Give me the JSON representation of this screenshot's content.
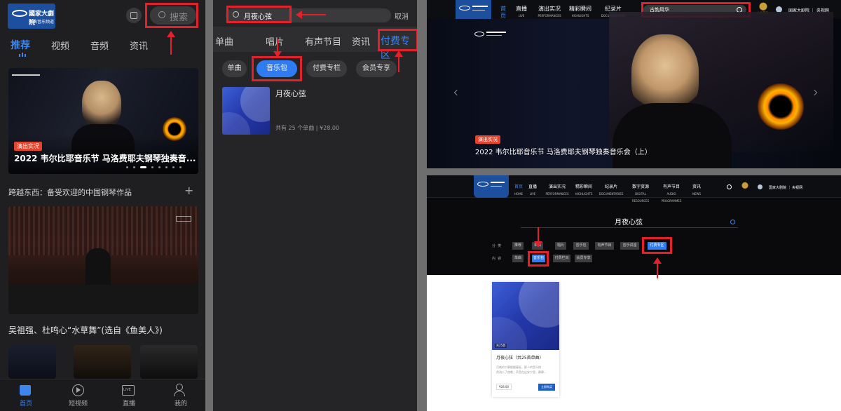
{
  "panel1": {
    "search_placeholder": "搜索",
    "tabs": [
      "推荐",
      "视频",
      "音频",
      "资讯"
    ],
    "logo_title": "國家大劇院",
    "logo_sub": "古典音乐频道",
    "hero": {
      "badge": "演出实况",
      "title": "2022 韦尔比耶音乐节 马洛费耶夫钢琴独奏音..."
    },
    "section_title": "跨越东西：备受欢迎的中国钢琴作品",
    "section_plus": "+",
    "card2_caption": "吴祖强、杜鸣心“水草舞”(选自《鱼美人》)",
    "bottom_nav": [
      "首页",
      "短视频",
      "直播",
      "我的"
    ],
    "live_label": "LIVE"
  },
  "panel2": {
    "search_value": "月夜心弦",
    "cancel": "取消",
    "tabs": [
      "单曲",
      "唱片",
      "有声节目",
      "资讯",
      "付费专区"
    ],
    "chips": [
      "单曲",
      "音乐包",
      "付费专栏",
      "会员专享"
    ],
    "result": {
      "title": "月夜心弦",
      "meta": "共有 25 个单曲 | ¥28.00"
    }
  },
  "panel3": {
    "nav": [
      {
        "cn": "首页",
        "en": "HOME"
      },
      {
        "cn": "直播",
        "en": "LIVE"
      },
      {
        "cn": "演出实况",
        "en": "PERFORMANCES"
      },
      {
        "cn": "精彩瞬间",
        "en": "HIGHLIGHTS"
      },
      {
        "cn": "纪录片",
        "en": "DOCUMENTARIES"
      }
    ],
    "search_value": "古韵风华",
    "right_text": "国家大剧院 ｜ 央视网",
    "hero": {
      "badge": "演出实况",
      "title": "2022 韦尔比耶音乐节 马洛费耶夫钢琴独奏音乐会（上）"
    },
    "brand_mark": "古典音乐"
  },
  "panel4": {
    "nav": [
      {
        "cn": "首页",
        "en": "HOME"
      },
      {
        "cn": "直播",
        "en": "LIVE"
      },
      {
        "cn": "演出实况",
        "en": "PERFORMANCES"
      },
      {
        "cn": "精彩瞬间",
        "en": "HIGHLIGHTS"
      },
      {
        "cn": "纪录片",
        "en": "DOCUMENTARIES"
      },
      {
        "cn": "数字资源",
        "en": "DIGITAL RESOURCES"
      },
      {
        "cn": "有声节目",
        "en": "AUDIO PROGRAMMES"
      },
      {
        "cn": "资讯",
        "en": "NEWS"
      }
    ],
    "right_text": "国家大剧院 ｜ 央视网",
    "search_value": "月夜心弦",
    "filter_row1_label": "分  类",
    "filter_row1": [
      "推荐",
      "单曲",
      "唱片",
      "音乐包",
      "有声节目",
      "音乐讲座",
      "付费专区"
    ],
    "filter_row2_label": "内  容",
    "filter_row2": [
      "单曲",
      "音乐包",
      "付费栏目",
      "会员专享"
    ],
    "card": {
      "count_badge": "共25首",
      "title": "月夜心弦（共25首单曲）",
      "desc_line1": "月夜的宁静缓缓蔓延，醉人的音乐悄",
      "desc_line2": "然流入了夜晚，声音在这安宁里，静静...",
      "price": "¥28.00",
      "buy": "立即购买"
    }
  },
  "colors": {
    "accent_blue": "#2f7bf2",
    "annotation_red": "#e3212b",
    "brand_blue": "#1c4f9e"
  }
}
